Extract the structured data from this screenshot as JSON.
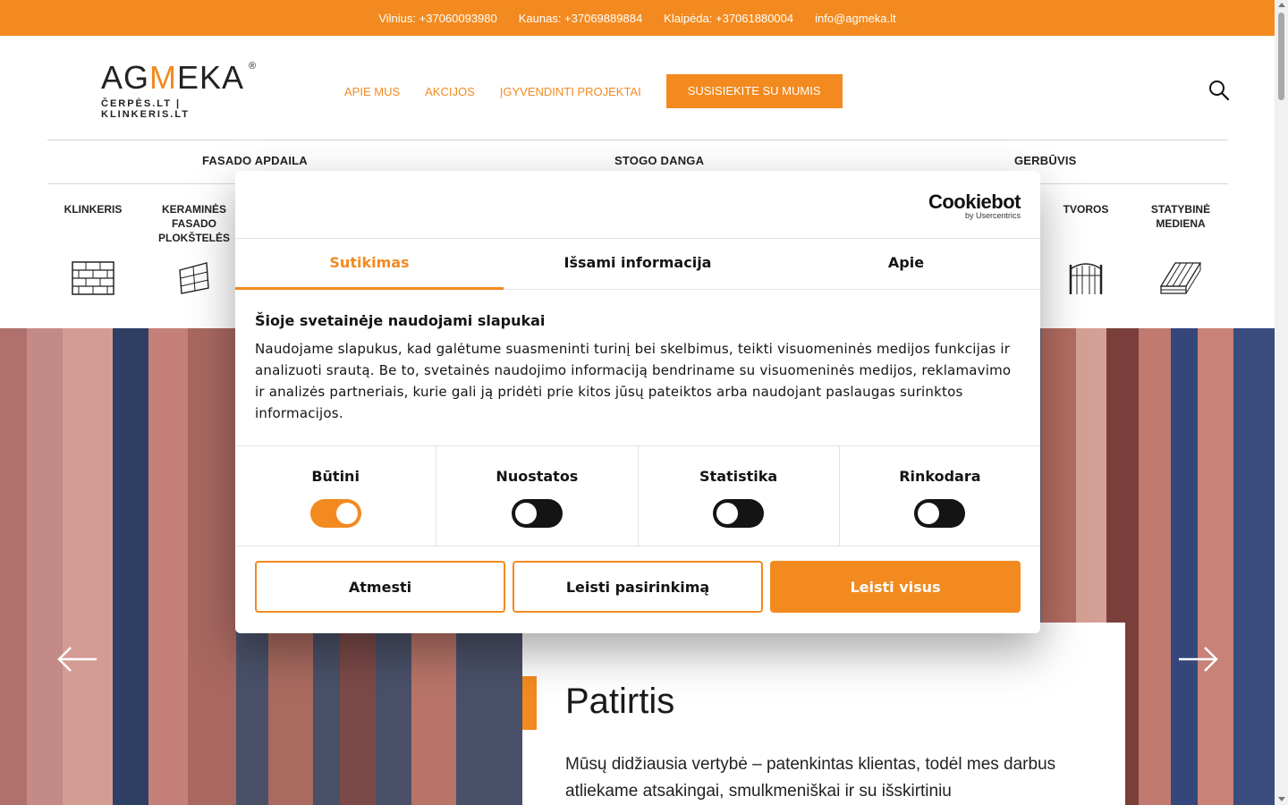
{
  "topbar": {
    "vilnius": "Vilnius: +37060093980",
    "kaunas": "Kaunas: +37069889884",
    "klaipeda": "Klaipėda: +37061880004",
    "email": "info@agmeka.lt"
  },
  "logo": {
    "word_left": "AG",
    "word_mid": "M",
    "word_right": "EKA",
    "reg": "®",
    "tagline": "ČERPĖS.LT | KLINKERIS.LT"
  },
  "nav": {
    "about": "APIE MUS",
    "offers": "AKCIJOS",
    "projects": "ĮGYVENDINTI PROJEKTAI",
    "contact": "SUSISIEKITE SU MUMIS"
  },
  "categories": {
    "facade": "FASADO APDAILA",
    "roof": "STOGO DANGA",
    "landscape": "GERBŪVIS"
  },
  "subcategories": {
    "klinkeris": "KLINKERIS",
    "keramines_1": "KERAMINĖS",
    "keramines_2": "FASADO",
    "keramines_3": "PLOKŠTELĖS",
    "tvoros": "TVOROS",
    "mediena_1": "STATYBINĖ",
    "mediena_2": "MEDIENA"
  },
  "hero": {
    "title": "Patirtis",
    "text": "Mūsų didžiausia vertybė – patenkintas klientas, todėl mes darbus atliekame atsakingai, smulkmeniškai ir su išskirtiniu"
  },
  "cookie": {
    "brand": "Cookiebot",
    "brand_by": "by Usercentrics",
    "tabs": [
      "Sutikimas",
      "Išsami informacija",
      "Apie"
    ],
    "title": "Šioje svetainėje naudojami slapukai",
    "body": "Naudojame slapukus, kad galėtume suasmeninti turinį bei skelbimus, teikti visuomeninės medijos funkcijas ir analizuoti srautą. Be to, svetainės naudojimo informaciją bendriname su visuomeninės medijos, reklamavimo ir analizės partneriais, kurie gali ją pridėti prie kitos jūsų pateiktos arba naudojant paslaugas surinktos informacijos.",
    "toggles": [
      "Būtini",
      "Nuostatos",
      "Statistika",
      "Rinkodara"
    ],
    "buttons": {
      "reject": "Atmesti",
      "allow_selection": "Leisti pasirinkimą",
      "allow_all": "Leisti visus"
    }
  },
  "colors": {
    "accent": "#f28a1f",
    "text": "#141414"
  }
}
